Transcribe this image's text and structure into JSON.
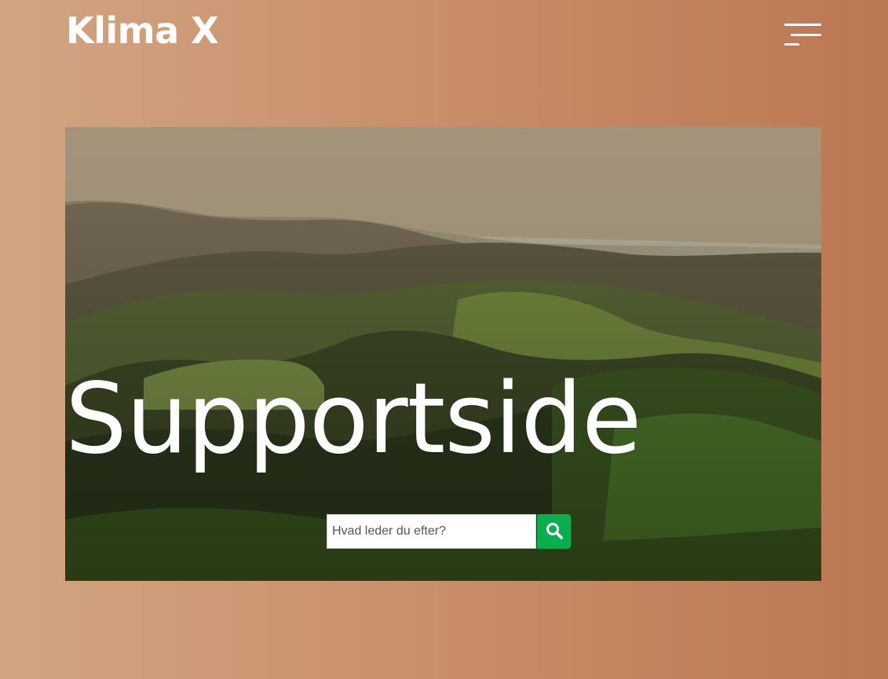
{
  "header": {
    "brand": "Klima X",
    "menu_icon": "menu-icon"
  },
  "hero": {
    "title": "Supportside",
    "search": {
      "placeholder": "Hvad leder du efter?",
      "value": "",
      "button_icon": "search-icon"
    }
  },
  "colors": {
    "background_gradient": [
      "#d2a582",
      "#bc7754"
    ],
    "search_button": "#0aae4d",
    "text": "#ffffff"
  }
}
